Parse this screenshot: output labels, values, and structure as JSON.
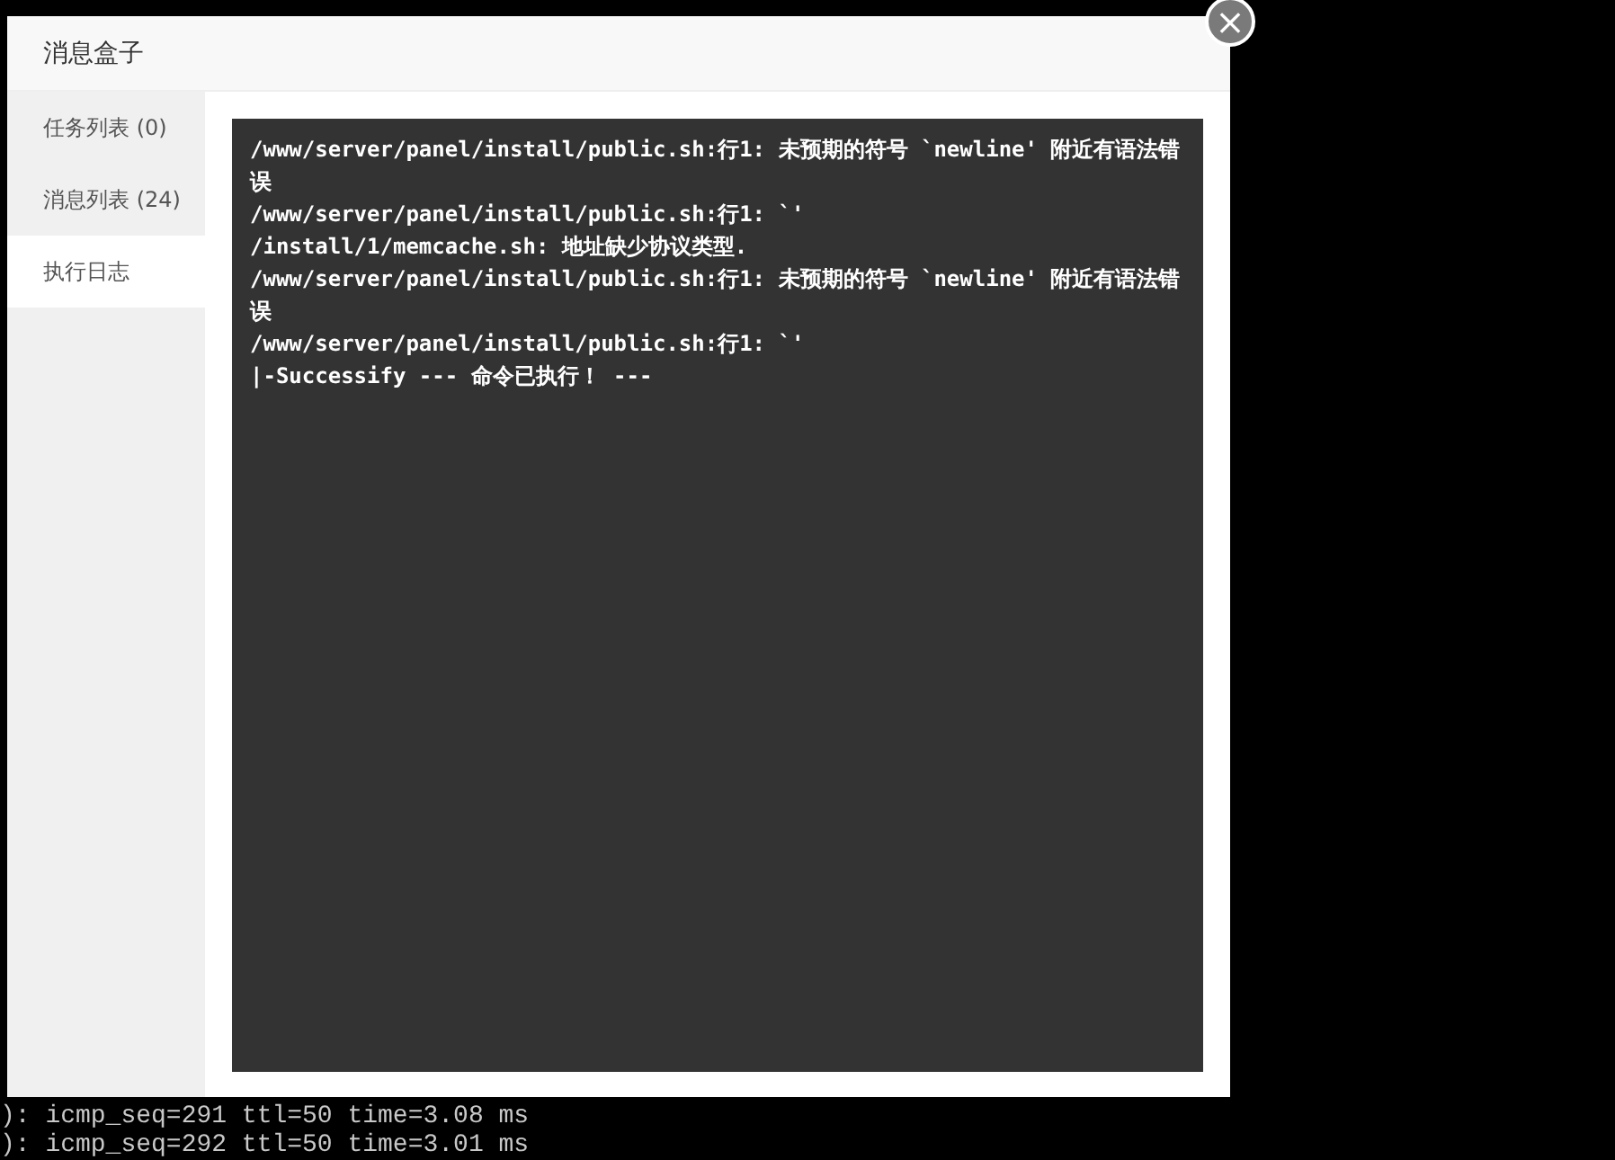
{
  "terminal": {
    "lines": [
      "): icmp_seq=291 ttl=50 time=3.08 ms",
      "): icmp_seq=292 ttl=50 time=3.01 ms"
    ]
  },
  "dialog": {
    "title": "消息盒子",
    "close": "×",
    "tabs": [
      {
        "label": "任务列表 (0)",
        "selected": false
      },
      {
        "label": "消息列表 (24)",
        "selected": false
      },
      {
        "label": "执行日志",
        "selected": true
      }
    ],
    "log": [
      "/www/server/panel/install/public.sh:行1: 未预期的符号 `newline' 附近有语法错误",
      "/www/server/panel/install/public.sh:行1: `'",
      "/install/1/memcache.sh: 地址缺少协议类型.",
      "/www/server/panel/install/public.sh:行1: 未预期的符号 `newline' 附近有语法错误",
      "/www/server/panel/install/public.sh:行1: `'",
      "|-Successify --- 命令已执行！ ---"
    ]
  }
}
